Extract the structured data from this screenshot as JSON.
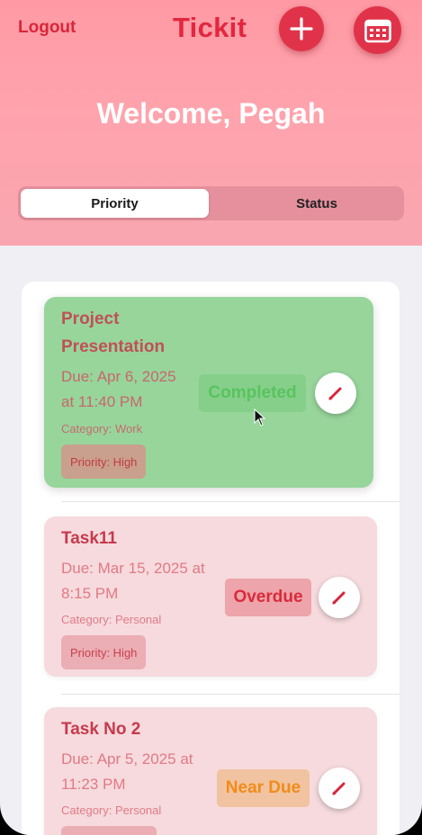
{
  "header": {
    "logout_label": "Logout",
    "app_title": "Tickit",
    "add_icon": "plus-icon",
    "calendar_icon": "calendar-icon",
    "welcome": "Welcome, Pegah"
  },
  "tabs": [
    {
      "label": "Priority",
      "selected": true
    },
    {
      "label": "Status",
      "selected": false
    }
  ],
  "tasks": [
    {
      "title_line1": "Project",
      "title_line2": "Presentation",
      "due_line1": "Due: Apr 6, 2025",
      "due_line2": "at 11:40 PM",
      "category": "Category: Work",
      "priority": "Priority: High",
      "status": "Completed",
      "status_color": "#58c45f"
    },
    {
      "title_line1": "Task11",
      "due_line1": "Due: Mar 15, 2025 at",
      "due_line2": "8:15 PM",
      "category": "Category: Personal",
      "priority": "Priority: High",
      "status": "Overdue",
      "status_color": "#d92b3b"
    },
    {
      "title_line1": "Task No 2",
      "due_line1": "Due: Apr 5, 2025 at",
      "due_line2": "11:23 PM",
      "category": "Category: Personal",
      "status": "Near Due",
      "status_color": "#f08c1a"
    }
  ],
  "colors": {
    "accent": "#e0334a",
    "header_bg": "#ffa3ad",
    "completed_card": "#97d59b",
    "pending_card": "#f6dadd"
  }
}
